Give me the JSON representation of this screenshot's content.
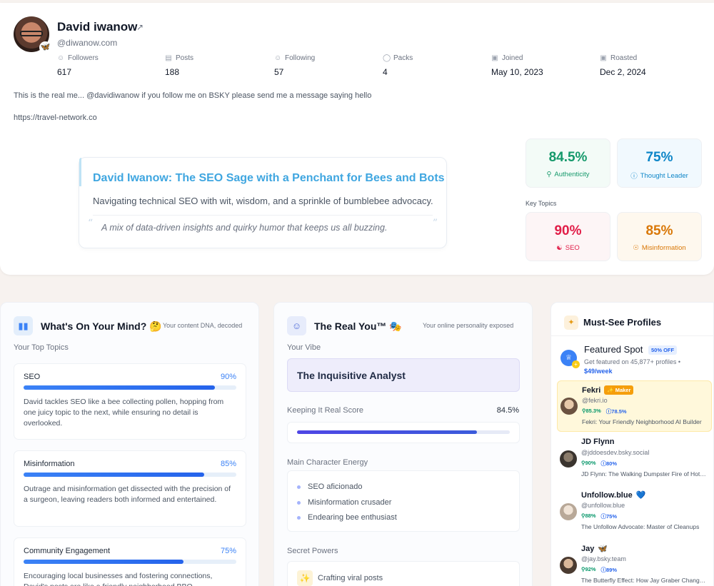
{
  "profile": {
    "name": "David iwanow",
    "handle": "@diwanow.com",
    "stats": [
      {
        "label": "Followers",
        "value": "617",
        "icon": "users-icon"
      },
      {
        "label": "Posts",
        "value": "188",
        "icon": "posts-icon"
      },
      {
        "label": "Following",
        "value": "57",
        "icon": "user-following-icon"
      },
      {
        "label": "Packs",
        "value": "4",
        "icon": "globe-icon"
      },
      {
        "label": "Joined",
        "value": "May 10, 2023",
        "icon": "calendar-icon"
      },
      {
        "label": "Roasted",
        "value": "Dec 2, 2024",
        "icon": "calendar-icon"
      }
    ],
    "bio": "This is the real me... @davidiwanow if you follow me on BSKY please send me a message saying hello",
    "link": "https://travel-network.co"
  },
  "roast": {
    "title": "David Iwanow: The SEO Sage with a Penchant for Bees and Bots",
    "subtitle": "Navigating technical SEO with wit, wisdom, and a sprinkle of bumblebee advocacy.",
    "quote": "A mix of data-driven insights and quirky humor that keeps us all buzzing.",
    "open_quote": "“",
    "close_quote": "”"
  },
  "metrics": {
    "authenticity": {
      "value": "84.5%",
      "label": "Authenticity",
      "color": "#15996b"
    },
    "thought_leader": {
      "value": "75%",
      "label": "Thought Leader",
      "color": "#0e86c8"
    },
    "key_topics_label": "Key Topics",
    "seo": {
      "value": "90%",
      "label": "SEO",
      "color": "#e11d48"
    },
    "misinformation": {
      "value": "85%",
      "label": "Misinformation",
      "color": "#d97706"
    }
  },
  "mind": {
    "title": "What's On Your Mind? 🤔",
    "subtitle": "Your content DNA, decoded",
    "section": "Your Top Topics",
    "topics": [
      {
        "name": "SEO",
        "pct": "90%",
        "value": 0.9,
        "desc": "David tackles SEO like a bee collecting pollen, hopping from one juicy topic to the next, while ensuring no detail is overlooked."
      },
      {
        "name": "Misinformation",
        "pct": "85%",
        "value": 0.85,
        "desc": "Outrage and misinformation get dissected with the precision of a surgeon, leaving readers both informed and entertained."
      },
      {
        "name": "Community Engagement",
        "pct": "75%",
        "value": 0.75,
        "desc": "Encouraging local businesses and fostering connections, David's posts are like a friendly neighborhood BBQ."
      }
    ]
  },
  "real_you": {
    "title": "The Real You™ 🎭",
    "subtitle": "Your online personality exposed",
    "vibe_label": "Your Vibe",
    "vibe": "The Inquisitive Analyst",
    "score_label": "Keeping It Real Score",
    "score": "84.5%",
    "score_value": 0.845,
    "energy_label": "Main Character Energy",
    "energy": [
      "SEO aficionado",
      "Misinformation crusader",
      "Endearing bee enthusiast"
    ],
    "powers_label": "Secret Powers",
    "power": "Crafting viral posts"
  },
  "must_see": {
    "title": "Must-See Profiles",
    "featured": {
      "title": "Featured Spot",
      "badge": "50% OFF",
      "desc": "Get featured on 45,877+ profiles •",
      "price": "$49/week"
    },
    "profiles": [
      {
        "name": "Fekri",
        "badge": "✨ Maker",
        "emoji": "",
        "handle": "@fekri.io",
        "a": "85.3%",
        "b": "78.5%",
        "desc": "Fekri: Your Friendly Neighborhood AI Builder",
        "highlight": true
      },
      {
        "name": "JD Flynn",
        "badge": "",
        "emoji": "",
        "handle": "@jddoesdev.bsky.social",
        "a": "90%",
        "b": "80%",
        "desc": "JD Flynn: The Walking Dumpster Fire of Hot Takes",
        "highlight": false
      },
      {
        "name": "Unfollow.blue",
        "badge": "",
        "emoji": "💙",
        "handle": "@unfollow.blue",
        "a": "88%",
        "b": "75%",
        "desc": "The Unfollow Advocate: Master of Cleanups",
        "highlight": false
      },
      {
        "name": "Jay",
        "badge": "",
        "emoji": "🦋",
        "handle": "@jay.bsky.team",
        "a": "92%",
        "b": "89%",
        "desc": "The Butterfly Effect: How Jay Graber Changed Everything",
        "highlight": false
      }
    ]
  }
}
